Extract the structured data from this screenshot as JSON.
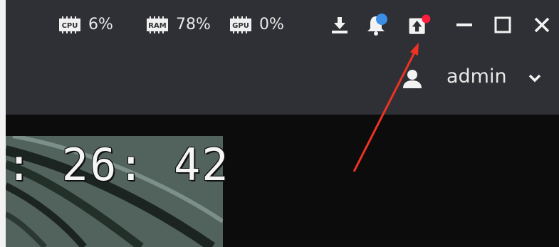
{
  "system_stats": {
    "cpu": {
      "chip_label": "CPU",
      "value": "6%"
    },
    "ram": {
      "chip_label": "RAM",
      "value": "78%"
    },
    "gpu": {
      "chip_label": "GPU",
      "value": "0%"
    }
  },
  "toolbar": {
    "icons": [
      "download-icon",
      "notification-bell-icon",
      "upload-icon",
      "minimize-icon",
      "maximize-icon",
      "close-icon"
    ],
    "bell_badge_color": "#3a8ee6",
    "upload_badge_color": "#ff1e3c"
  },
  "user": {
    "name": "admin"
  },
  "video": {
    "timestamp": ": 26: 42"
  },
  "colors": {
    "titlebar": "#2e3035",
    "content": "#0c0c0d",
    "annotation_arrow": "#ee3324"
  }
}
